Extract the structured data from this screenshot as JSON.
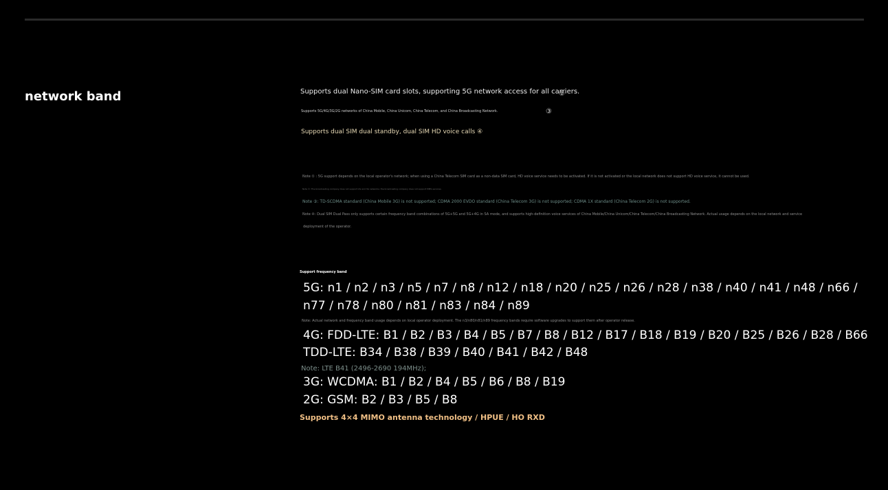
{
  "section": {
    "title": "network band"
  },
  "sim": {
    "line1": "Supports dual Nano-SIM card slots, supporting 5G network access for all carriers.",
    "mark1": "①",
    "line2": "Supports 5G/4G/3G/2G networks of China Mobile, China Unicom, China Telecom, and China Broadcasting Network.",
    "mark2": "③",
    "line3": "Supports dual SIM dual standby, dual SIM HD voice calls ④"
  },
  "notes": {
    "note1": "Note ① : 5G support depends on the local operator's network; when using a China Telecom SIM card as a non-data SIM card, HD voice service needs to be activated. If it is not activated or the local network does not support HD voice service, it cannot be used.",
    "note2": "Note ②: The broadcasting company does not support 2G and 3G networks; the broadcasting company does not support MMS services.",
    "note3": "Note ③: TD-SCDMA standard (China Mobile 3G) is not supported; CDMA 2000 EVDO standard (China Telecom 3G) is not supported; CDMA 1X standard (China Telecom 2G) is not supported.",
    "note4": "Note ④: Dual SIM Dual Pass only supports certain frequency band combinations of 5G+5G and 5G+4G in SA mode, and supports high-definition voice services of China Mobile/China Unicom/China Telecom/China Broadcasting Network. Actual usage depends on the local network and service",
    "note4_cont": "deployment of the operator."
  },
  "bands": {
    "heading": "Support frequency band",
    "g5_line1": "5G: n1 / n2 / n3 / n5 / n7 / n8 / n12 / n18 / n20 / n25 / n26 / n28 / n38 / n40 / n41 / n48 / n66 /",
    "g5_line2": "n77 / n78 / n80 / n81 / n83 / n84 / n89",
    "g5_note": "Note: Actual network and frequency band usage depends on local operator deployment. The n3/n80/n81/n89 frequency bands require software upgrades to support them after operator release.",
    "g4_line1": "4G: FDD-LTE: B1 / B2 / B3 / B4 / B5 / B7 / B8 / B12 / B17 / B18 / B19 / B20 / B25 / B26 / B28 / B66",
    "g4_line2": "TDD-LTE: B34 / B38 / B39 / B40 / B41 / B42 / B48",
    "b41_note": "Note: LTE B41 (2496-2690 194MHz);",
    "g3": "3G: WCDMA: B1 / B2 / B4 / B5 / B6 / B8 / B19",
    "g2": "2G: GSM: B2 / B3 / B5 / B8"
  },
  "mimo": "Supports 4×4 MIMO antenna technology / HPUE / HO RXD",
  "colors": {
    "background": "#000000",
    "accent_gold": "#f0bf85",
    "soft_gold": "#e7d9b5",
    "note_teal": "#6f8f8a",
    "rule": "#2a2a2a"
  }
}
